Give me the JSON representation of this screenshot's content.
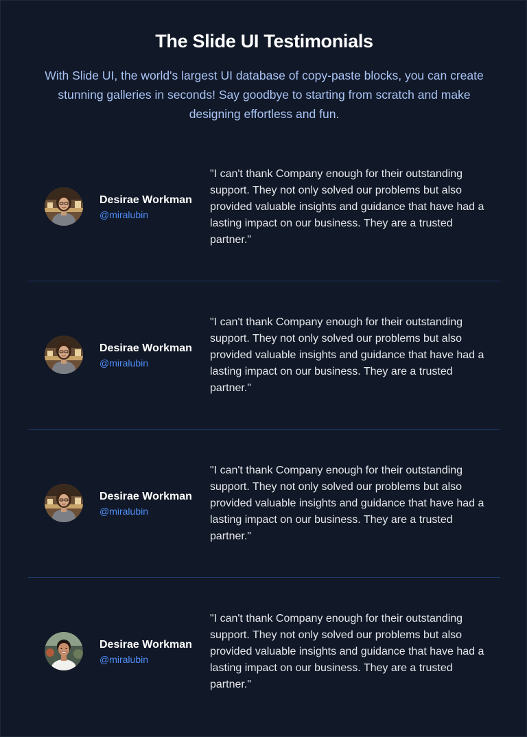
{
  "header": {
    "title": "The Slide UI Testimonials",
    "subtitle": "With Slide UI, the world's largest UI database of copy-paste blocks, you can create stunning galleries in seconds! Say goodbye to starting from scratch and make designing effortless and fun."
  },
  "colors": {
    "background": "#111827",
    "handle": "#4f8ef7",
    "subtitle": "#a9c4f5",
    "divider": "#1e3a6a"
  },
  "testimonials": [
    {
      "name": "Desirae Workman",
      "handle": "@miralubin",
      "quote": "\"I can't thank Company enough for their outstanding support. They not only solved our problems but also provided valuable insights and guidance that have had a lasting impact on our business. They are a trusted partner.\"",
      "avatar_icon": "woman-portrait-photo"
    },
    {
      "name": "Desirae Workman",
      "handle": "@miralubin",
      "quote": "\"I can't thank Company enough for their outstanding support. They not only solved our problems but also provided valuable insights and guidance that have had a lasting impact on our business. They are a trusted partner.\"",
      "avatar_icon": "woman-portrait-photo"
    },
    {
      "name": "Desirae Workman",
      "handle": "@miralubin",
      "quote": "\"I can't thank Company enough for their outstanding support. They not only solved our problems but also provided valuable insights and guidance that have had a lasting impact on our business. They are a trusted partner.\"",
      "avatar_icon": "woman-portrait-photo"
    },
    {
      "name": "Desirae Workman",
      "handle": "@miralubin",
      "quote": "\"I can't thank Company enough for their outstanding support. They not only solved our problems but also provided valuable insights and guidance that have had a lasting impact on our business. They are a trusted partner.\"",
      "avatar_icon": "man-portrait-photo"
    }
  ]
}
